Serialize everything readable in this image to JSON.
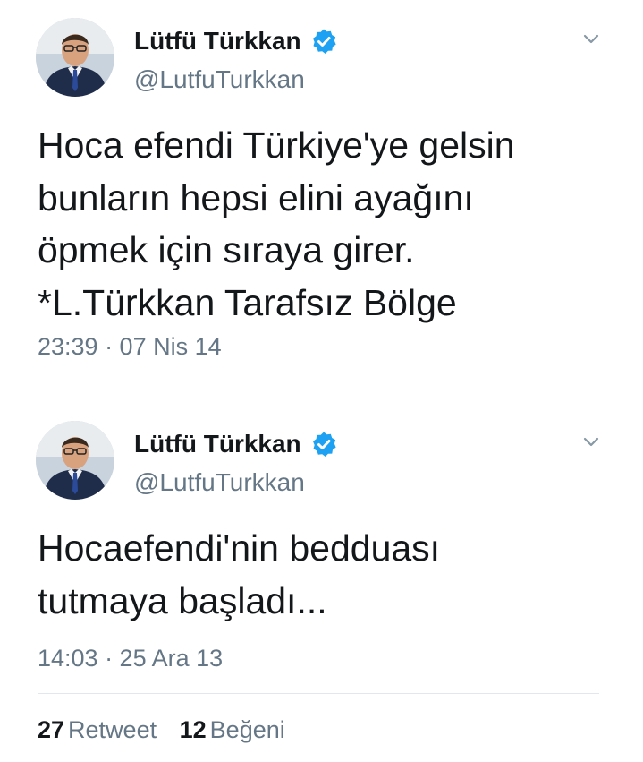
{
  "colors": {
    "text_primary": "#14171a",
    "text_secondary": "#657786",
    "verified_blue": "#1da1f2",
    "divider": "#e1e8ed"
  },
  "tweets": [
    {
      "author": {
        "display_name": "Lütfü Türkkan",
        "handle": "@LutfuTurkkan",
        "verified_icon": "verified-badge-icon",
        "avatar": "avatar"
      },
      "text_lines": [
        "Hoca efendi Türkiye'ye gelsin",
        "bunların hepsi elini ayağını",
        "öpmek için sıraya girer.",
        "*L.Türkkan Tarafsız Bölge"
      ],
      "timestamp": "23:39 · 07 Nis 14",
      "menu_icon": "chevron-down-icon"
    },
    {
      "author": {
        "display_name": "Lütfü Türkkan",
        "handle": "@LutfuTurkkan",
        "verified_icon": "verified-badge-icon",
        "avatar": "avatar"
      },
      "text_lines": [
        "Hocaefendi'nin bedduası",
        "tutmaya başladı..."
      ],
      "timestamp": "14:03 · 25 Ara 13",
      "menu_icon": "chevron-down-icon"
    }
  ],
  "stats": {
    "retweets": {
      "count": "27",
      "label": "Retweet"
    },
    "likes": {
      "count": "12",
      "label": "Beğeni"
    }
  }
}
